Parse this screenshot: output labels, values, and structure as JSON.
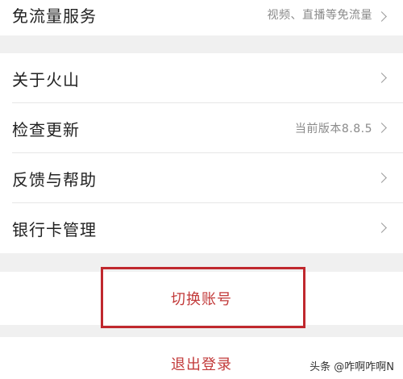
{
  "menu_group_1": {
    "items": [
      {
        "label": "免流量服务",
        "value": "视频、直播等免流量"
      }
    ]
  },
  "menu_group_2": {
    "items": [
      {
        "label": "关于火山",
        "value": ""
      },
      {
        "label": "检查更新",
        "value": "当前版本8.8.5"
      },
      {
        "label": "反馈与帮助",
        "value": ""
      },
      {
        "label": "银行卡管理",
        "value": ""
      }
    ]
  },
  "actions": {
    "switch_account": "切换账号",
    "logout": "退出登录"
  },
  "watermark": "头条 @咋啊咋啊N",
  "colors": {
    "accent": "#c23a3a",
    "highlight_border": "#c0282e",
    "background": "#f0f0f0"
  }
}
